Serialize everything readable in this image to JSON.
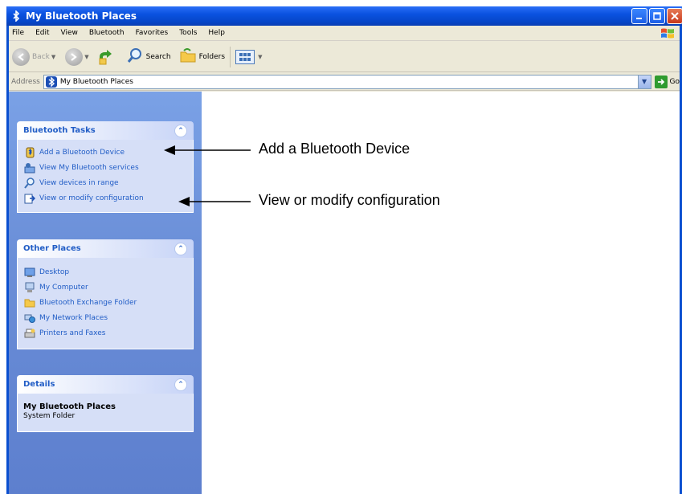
{
  "window": {
    "title": "My Bluetooth Places"
  },
  "menu": [
    "File",
    "Edit",
    "View",
    "Bluetooth",
    "Favorites",
    "Tools",
    "Help"
  ],
  "toolbar": {
    "back_label": "Back",
    "search_label": "Search",
    "folders_label": "Folders"
  },
  "address": {
    "label": "Address",
    "value": "My Bluetooth Places",
    "go_label": "Go"
  },
  "sidebar": {
    "bluetooth_tasks": {
      "title": "Bluetooth Tasks",
      "items": [
        {
          "label": "Add a Bluetooth Device",
          "icon": "bluetooth-device-icon"
        },
        {
          "label": "View My Bluetooth services",
          "icon": "bluetooth-services-icon"
        },
        {
          "label": "View devices in range",
          "icon": "search-devices-icon"
        },
        {
          "label": "View or modify configuration",
          "icon": "configuration-icon"
        }
      ]
    },
    "other_places": {
      "title": "Other Places",
      "items": [
        {
          "label": "Desktop",
          "icon": "desktop-icon"
        },
        {
          "label": "My Computer",
          "icon": "my-computer-icon"
        },
        {
          "label": "Bluetooth Exchange Folder",
          "icon": "folder-icon"
        },
        {
          "label": "My Network Places",
          "icon": "network-places-icon"
        },
        {
          "label": "Printers and Faxes",
          "icon": "printers-faxes-icon"
        }
      ]
    },
    "details": {
      "title": "Details",
      "name": "My Bluetooth Places",
      "type": "System Folder"
    }
  },
  "callouts": {
    "add_device": "Add a Bluetooth Device",
    "modify_config": "View or modify configuration"
  }
}
